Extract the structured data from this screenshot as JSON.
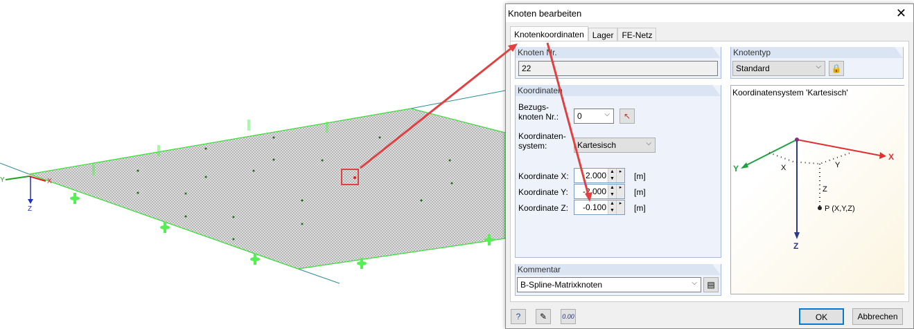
{
  "viewport": {
    "axis_labels": {
      "x": "X",
      "y": "Y",
      "z": "Z"
    },
    "colors": {
      "plate_edge": "#33dd33",
      "support": "#55ee55",
      "highlight": "#e03030",
      "axis_x": "#e02020",
      "axis_y": "#20a020",
      "axis_z": "#2030c0"
    }
  },
  "dialog": {
    "title": "Knoten bearbeiten",
    "close_icon": "close-icon",
    "tabs": [
      {
        "label": "Knotenkoordinaten",
        "active": true
      },
      {
        "label": "Lager"
      },
      {
        "label": "FE-Netz"
      }
    ],
    "node_number": {
      "header": "Knoten Nr.",
      "value": "22"
    },
    "node_type": {
      "header": "Knotentyp",
      "value": "Standard",
      "lock_icon": "lock-icon"
    },
    "coordinates": {
      "header": "Koordinaten",
      "ref_node_label_1": "Bezugs-",
      "ref_node_label_2": "knoten Nr.:",
      "ref_node_value": "0",
      "system_label_1": "Koordinaten-",
      "system_label_2": "system:",
      "system_value": "Kartesisch",
      "rows": [
        {
          "label": "Koordinate X:",
          "value": "2.000",
          "unit": "[m]"
        },
        {
          "label": "Koordinate Y:",
          "value": "-2.000",
          "unit": "[m]"
        },
        {
          "label": "Koordinate Z:",
          "value": "-0.100",
          "unit": "[m]"
        }
      ]
    },
    "diagram": {
      "title": "Koordinatensystem 'Kartesisch'",
      "x": "X",
      "y": "Y",
      "z": "Z",
      "dx": "X",
      "dy": "Y",
      "dz": "Z",
      "point": "P (X,Y,Z)"
    },
    "comment": {
      "header": "Kommentar",
      "value": "B-Spline-Matrixknoten"
    },
    "buttons": {
      "ok": "OK",
      "cancel": "Abbrechen"
    }
  }
}
